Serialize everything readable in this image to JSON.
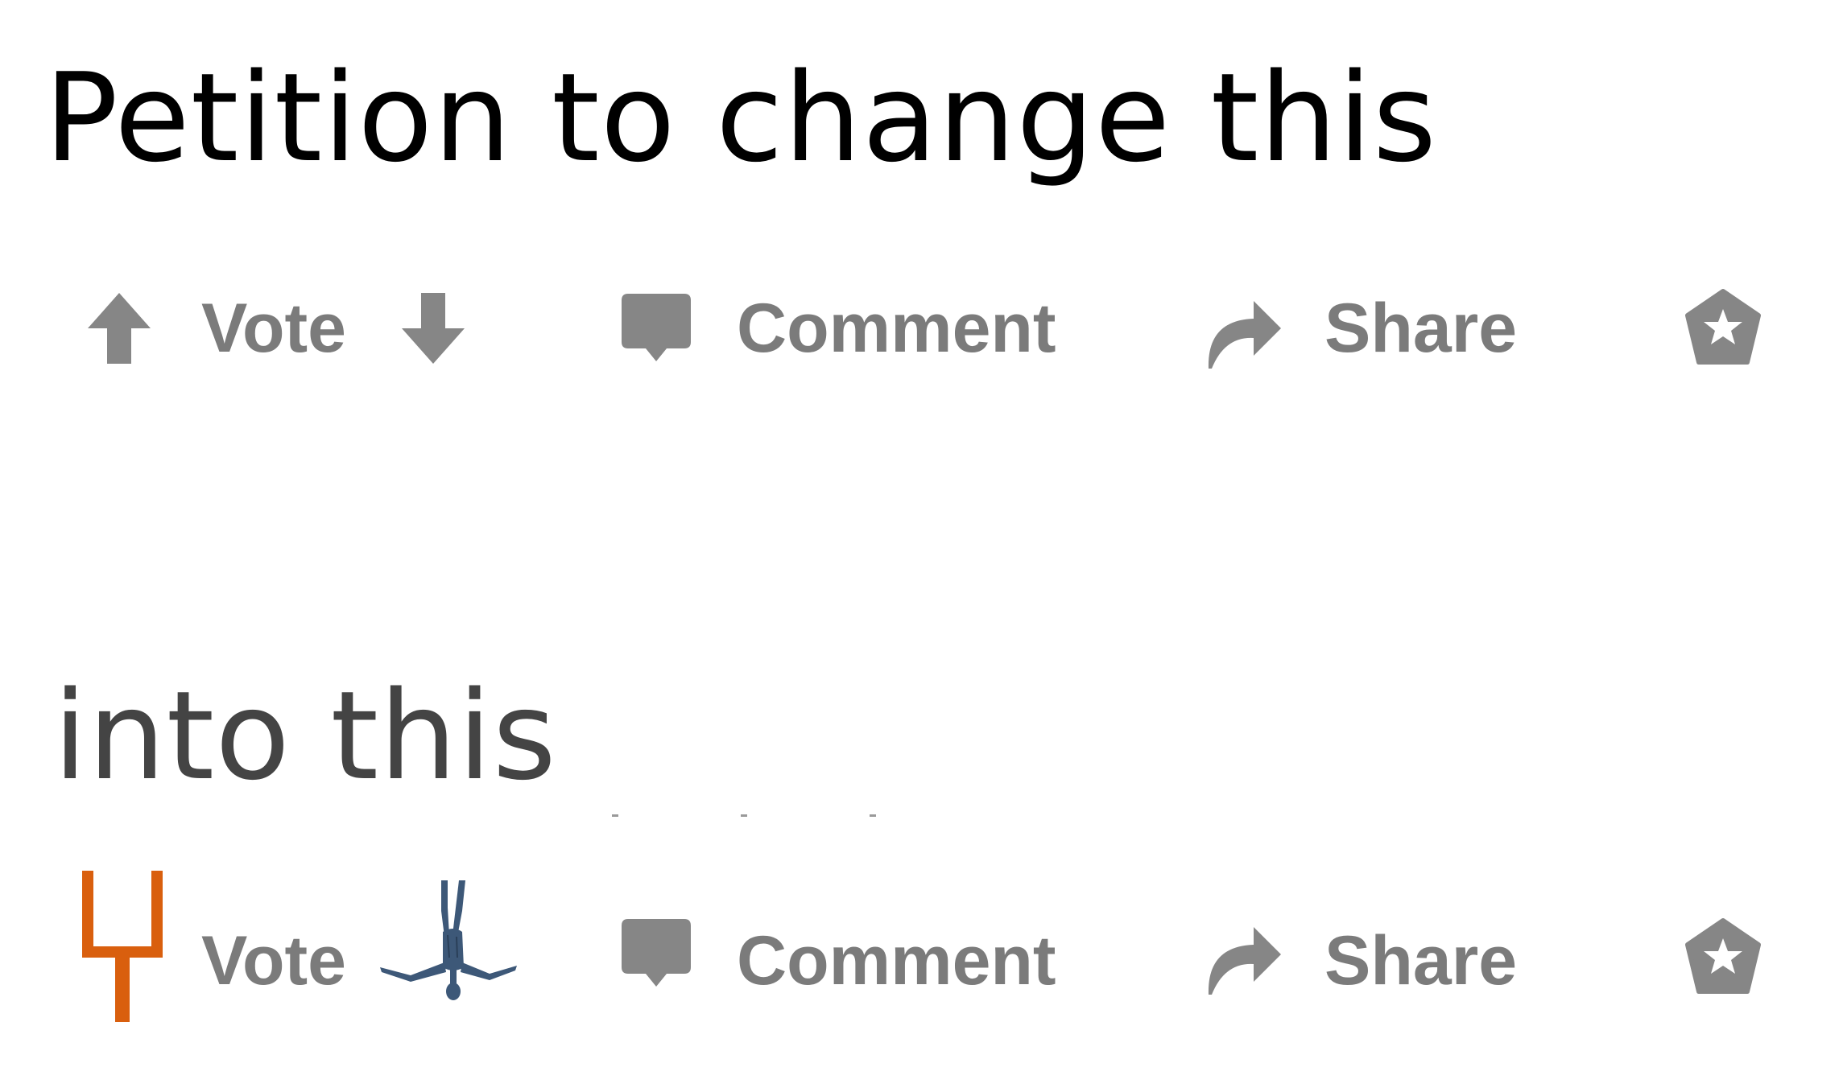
{
  "headline_top": "Petition to change this",
  "headline_bottom": "into this",
  "bar_original": {
    "vote_label": "Vote",
    "comment_label": "Comment",
    "share_label": "Share"
  },
  "bar_new": {
    "vote_label": "Vote",
    "comment_label": "Comment",
    "share_label": "Share"
  },
  "icons": {
    "upvote": "arrow-up-icon",
    "downvote": "arrow-down-icon",
    "comment": "speech-bubble-icon",
    "share": "curved-arrow-icon",
    "award": "star-badge-icon",
    "upvote_replacement": "goalpost-icon",
    "downvote_replacement": "upside-down-figure-icon"
  },
  "colors": {
    "icon_gray": "#868686",
    "label_gray": "#7b7b7b",
    "goalpost_orange": "#d95f0e",
    "figure_blue": "#3d5878"
  }
}
